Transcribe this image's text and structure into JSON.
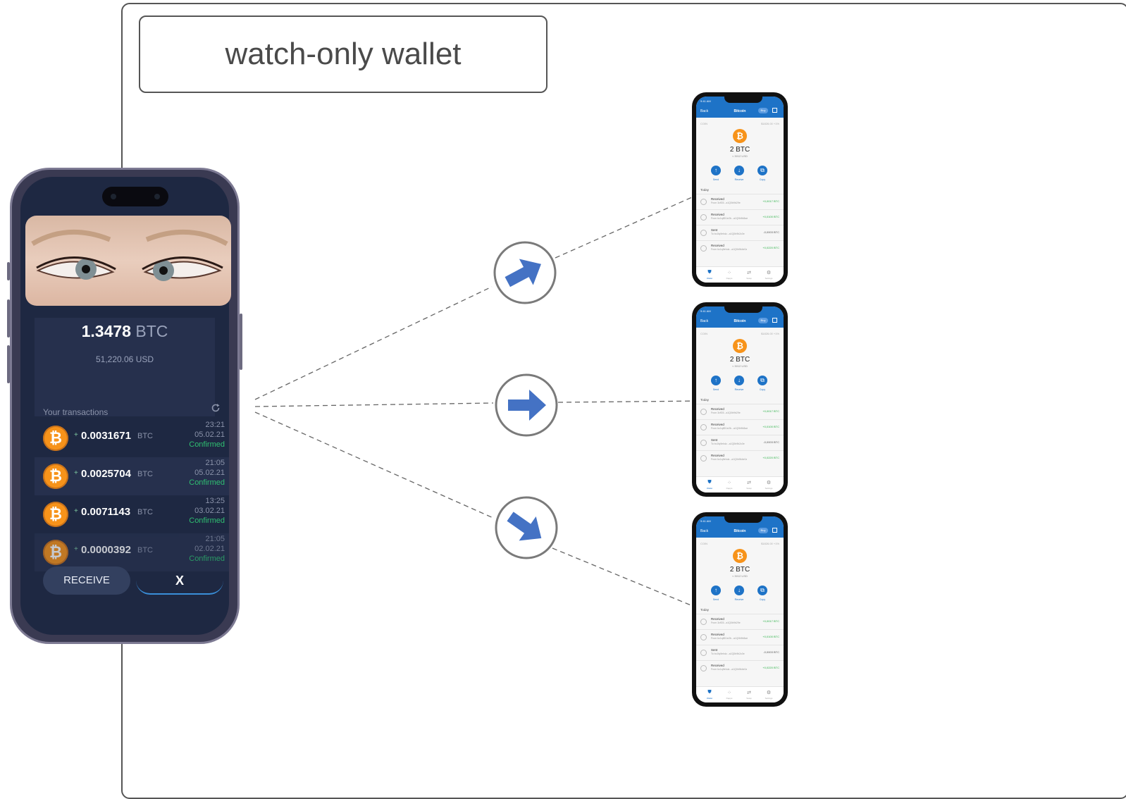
{
  "title": "watch-only wallet",
  "main_wallet": {
    "balance_value": "1.3478",
    "balance_unit": "BTC",
    "balance_usd": "51,220.06 USD",
    "transactions_header": "Your transactions",
    "transactions": [
      {
        "sign": "+",
        "amount": "0.0031671",
        "unit": "BTC",
        "time": "23:21",
        "date": "05.02.21",
        "status": "Confirmed"
      },
      {
        "sign": "+",
        "amount": "0.0025704",
        "unit": "BTC",
        "time": "21:05",
        "date": "05.02.21",
        "status": "Confirmed"
      },
      {
        "sign": "+",
        "amount": "0.0071143",
        "unit": "BTC",
        "time": "13:25",
        "date": "03.02.21",
        "status": "Confirmed"
      },
      {
        "sign": "+",
        "amount": "0.0000392",
        "unit": "BTC",
        "time": "21:05",
        "date": "02.02.21",
        "status": "Confirmed"
      }
    ],
    "receive_label": "RECEIVE",
    "close_label": "X"
  },
  "watch_phone": {
    "status_time": "9:41 AM",
    "back_label": "Back",
    "screen_title": "Bitcoin",
    "buy_label": "Buy",
    "coin_ticker": "COIN",
    "price_info": "$1826.00 +1%",
    "amount": "2 BTC",
    "amount_usd": "≈ 3012 USD",
    "actions": [
      "Send",
      "Receive",
      "Copy"
    ],
    "section_label": "Today",
    "rows": [
      {
        "label": "Received",
        "sub": "From 3cfG5...a1Q0b9b29e",
        "value": "+0,0017 BTC",
        "color": "#2fb24a"
      },
      {
        "label": "Received",
        "sub": "From bc1q8D1e2b...a1Q0b9b8ae",
        "value": "+0,0100 BTC",
        "color": "#2fb24a"
      },
      {
        "label": "Sent",
        "sub": "To bc1fq9ehdz...a1Q0b9b2c0e",
        "value": "-0,0003 BTC",
        "color": "#555555"
      },
      {
        "label": "Received",
        "sub": "From bc1q9ehdz...a1Q0b9b4e0z",
        "value": "+0,0220 BTC",
        "color": "#2fb24a"
      }
    ],
    "nav": [
      "Wallet",
      "Dapps",
      "Swap",
      "Settings"
    ]
  },
  "colors": {
    "accent_blue": "#4472c4",
    "bitcoin_orange": "#f7931a",
    "confirmed_green": "#2fbf71"
  },
  "icons": [
    "bitcoin-icon",
    "refresh-icon",
    "arrow-up-right-icon",
    "arrow-right-icon",
    "arrow-down-right-icon"
  ]
}
